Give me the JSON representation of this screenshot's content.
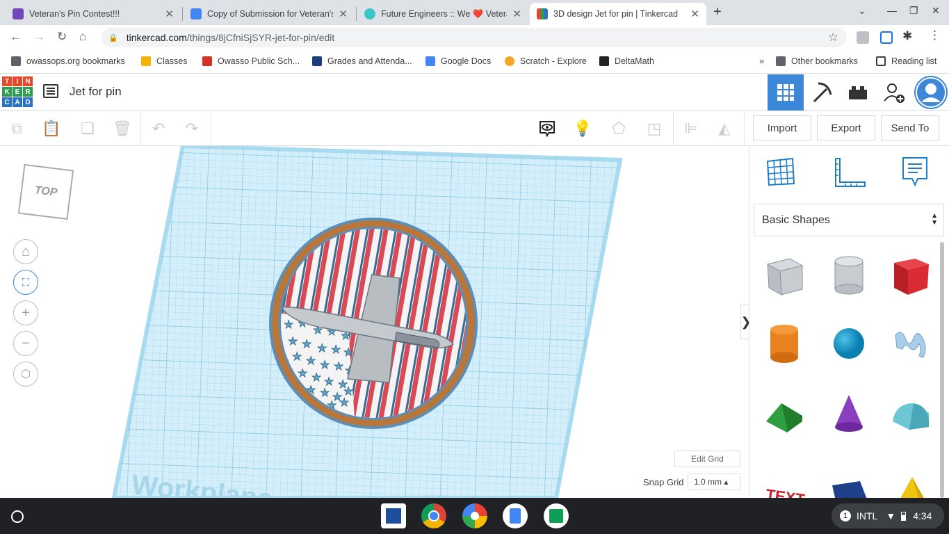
{
  "tabs": [
    {
      "title": "Veteran's Pin Contest!!!",
      "favicon_color": "#7248b9"
    },
    {
      "title": "Copy of Submission for Veteran's",
      "favicon_color": "#4285f4"
    },
    {
      "title": "Future Engineers :: We ❤️ Vetera",
      "favicon_color": "#38c6c6"
    },
    {
      "title": "3D design Jet for pin | Tinkercad",
      "favicon_color": "#e8472b"
    }
  ],
  "address": {
    "host": "tinkercad.com",
    "path": "/things/8jCfniSjSYR-jet-for-pin/edit"
  },
  "bookmarks": [
    {
      "label": "owassops.org bookmarks",
      "color": "#5f6368"
    },
    {
      "label": "Classes",
      "color": "#f4b400"
    },
    {
      "label": "Owasso Public Sch...",
      "color": "#d93025"
    },
    {
      "label": "Grades and Attenda...",
      "color": "#1a3d7c"
    },
    {
      "label": "Google Docs",
      "color": "#4285f4"
    },
    {
      "label": "Scratch - Explore",
      "color": "#f5a623"
    },
    {
      "label": "DeltaMath",
      "color": "#222222"
    }
  ],
  "bookmarks_right": {
    "more": "»",
    "other": "Other bookmarks",
    "reading": "Reading list"
  },
  "logo_letters": [
    "T",
    "I",
    "N",
    "K",
    "E",
    "R",
    "C",
    "A",
    "D"
  ],
  "design_title": "Jet for pin",
  "actions": {
    "import": "Import",
    "export": "Export",
    "send_to": "Send To"
  },
  "viewcube_label": "TOP",
  "workplane_watermark": "Workplane",
  "grid": {
    "edit_label": "Edit Grid",
    "snap_label": "Snap Grid",
    "snap_value": "1.0 mm ▴"
  },
  "shape_category": "Basic Shapes",
  "shelf": {
    "notification_count": "1",
    "input": "INTL",
    "time": "4:34"
  }
}
